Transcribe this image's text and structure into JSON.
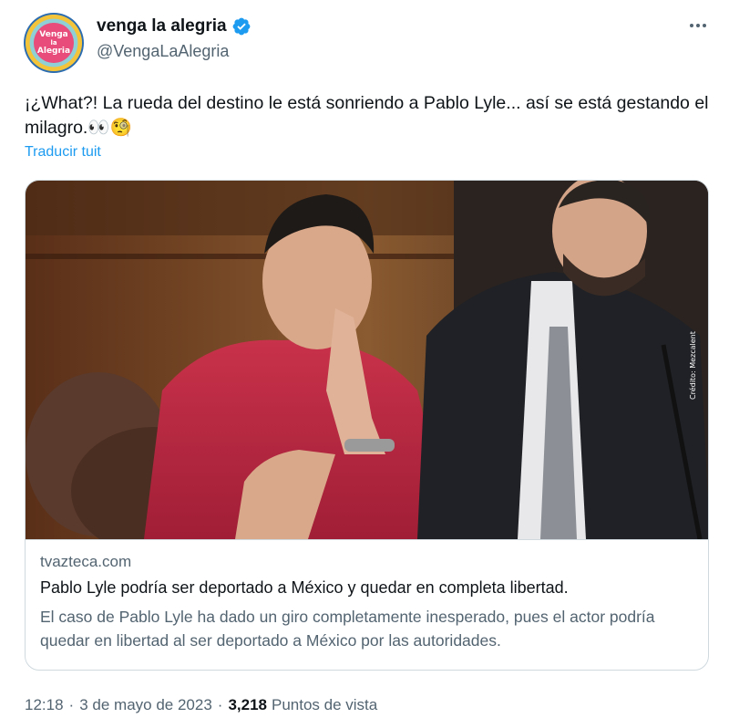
{
  "author": {
    "display_name": "venga la alegria",
    "handle": "@VengaLaAlegria",
    "avatar_text": [
      "Venga",
      "la",
      "Alegria"
    ],
    "verified": true,
    "verified_color": "#1d9bf0"
  },
  "tweet": {
    "text": "¡¿What?! La rueda del destino le está sonriendo a Pablo Lyle... así se está gestando el milagro.",
    "emoji": "👀🧐",
    "translate_label": "Traducir tuit"
  },
  "card": {
    "image_alt": "photo-courtroom",
    "image_credit": "Crédito: Mezcalent",
    "domain": "tvazteca.com",
    "title": "Pablo Lyle podría ser deportado a México y quedar en completa libertad.",
    "description": "El caso de Pablo Lyle ha dado un giro completamente inesperado, pues el actor podría quedar en libertad al ser deportado a México por las autoridades."
  },
  "footer": {
    "time": "12:18",
    "separator": "·",
    "date": "3 de mayo de 2023",
    "views_count": "3,218",
    "views_label": "Puntos de vista"
  },
  "colors": {
    "text_primary": "#0f1419",
    "text_secondary": "#536471",
    "link": "#1d9bf0",
    "border": "#cfd9de"
  }
}
